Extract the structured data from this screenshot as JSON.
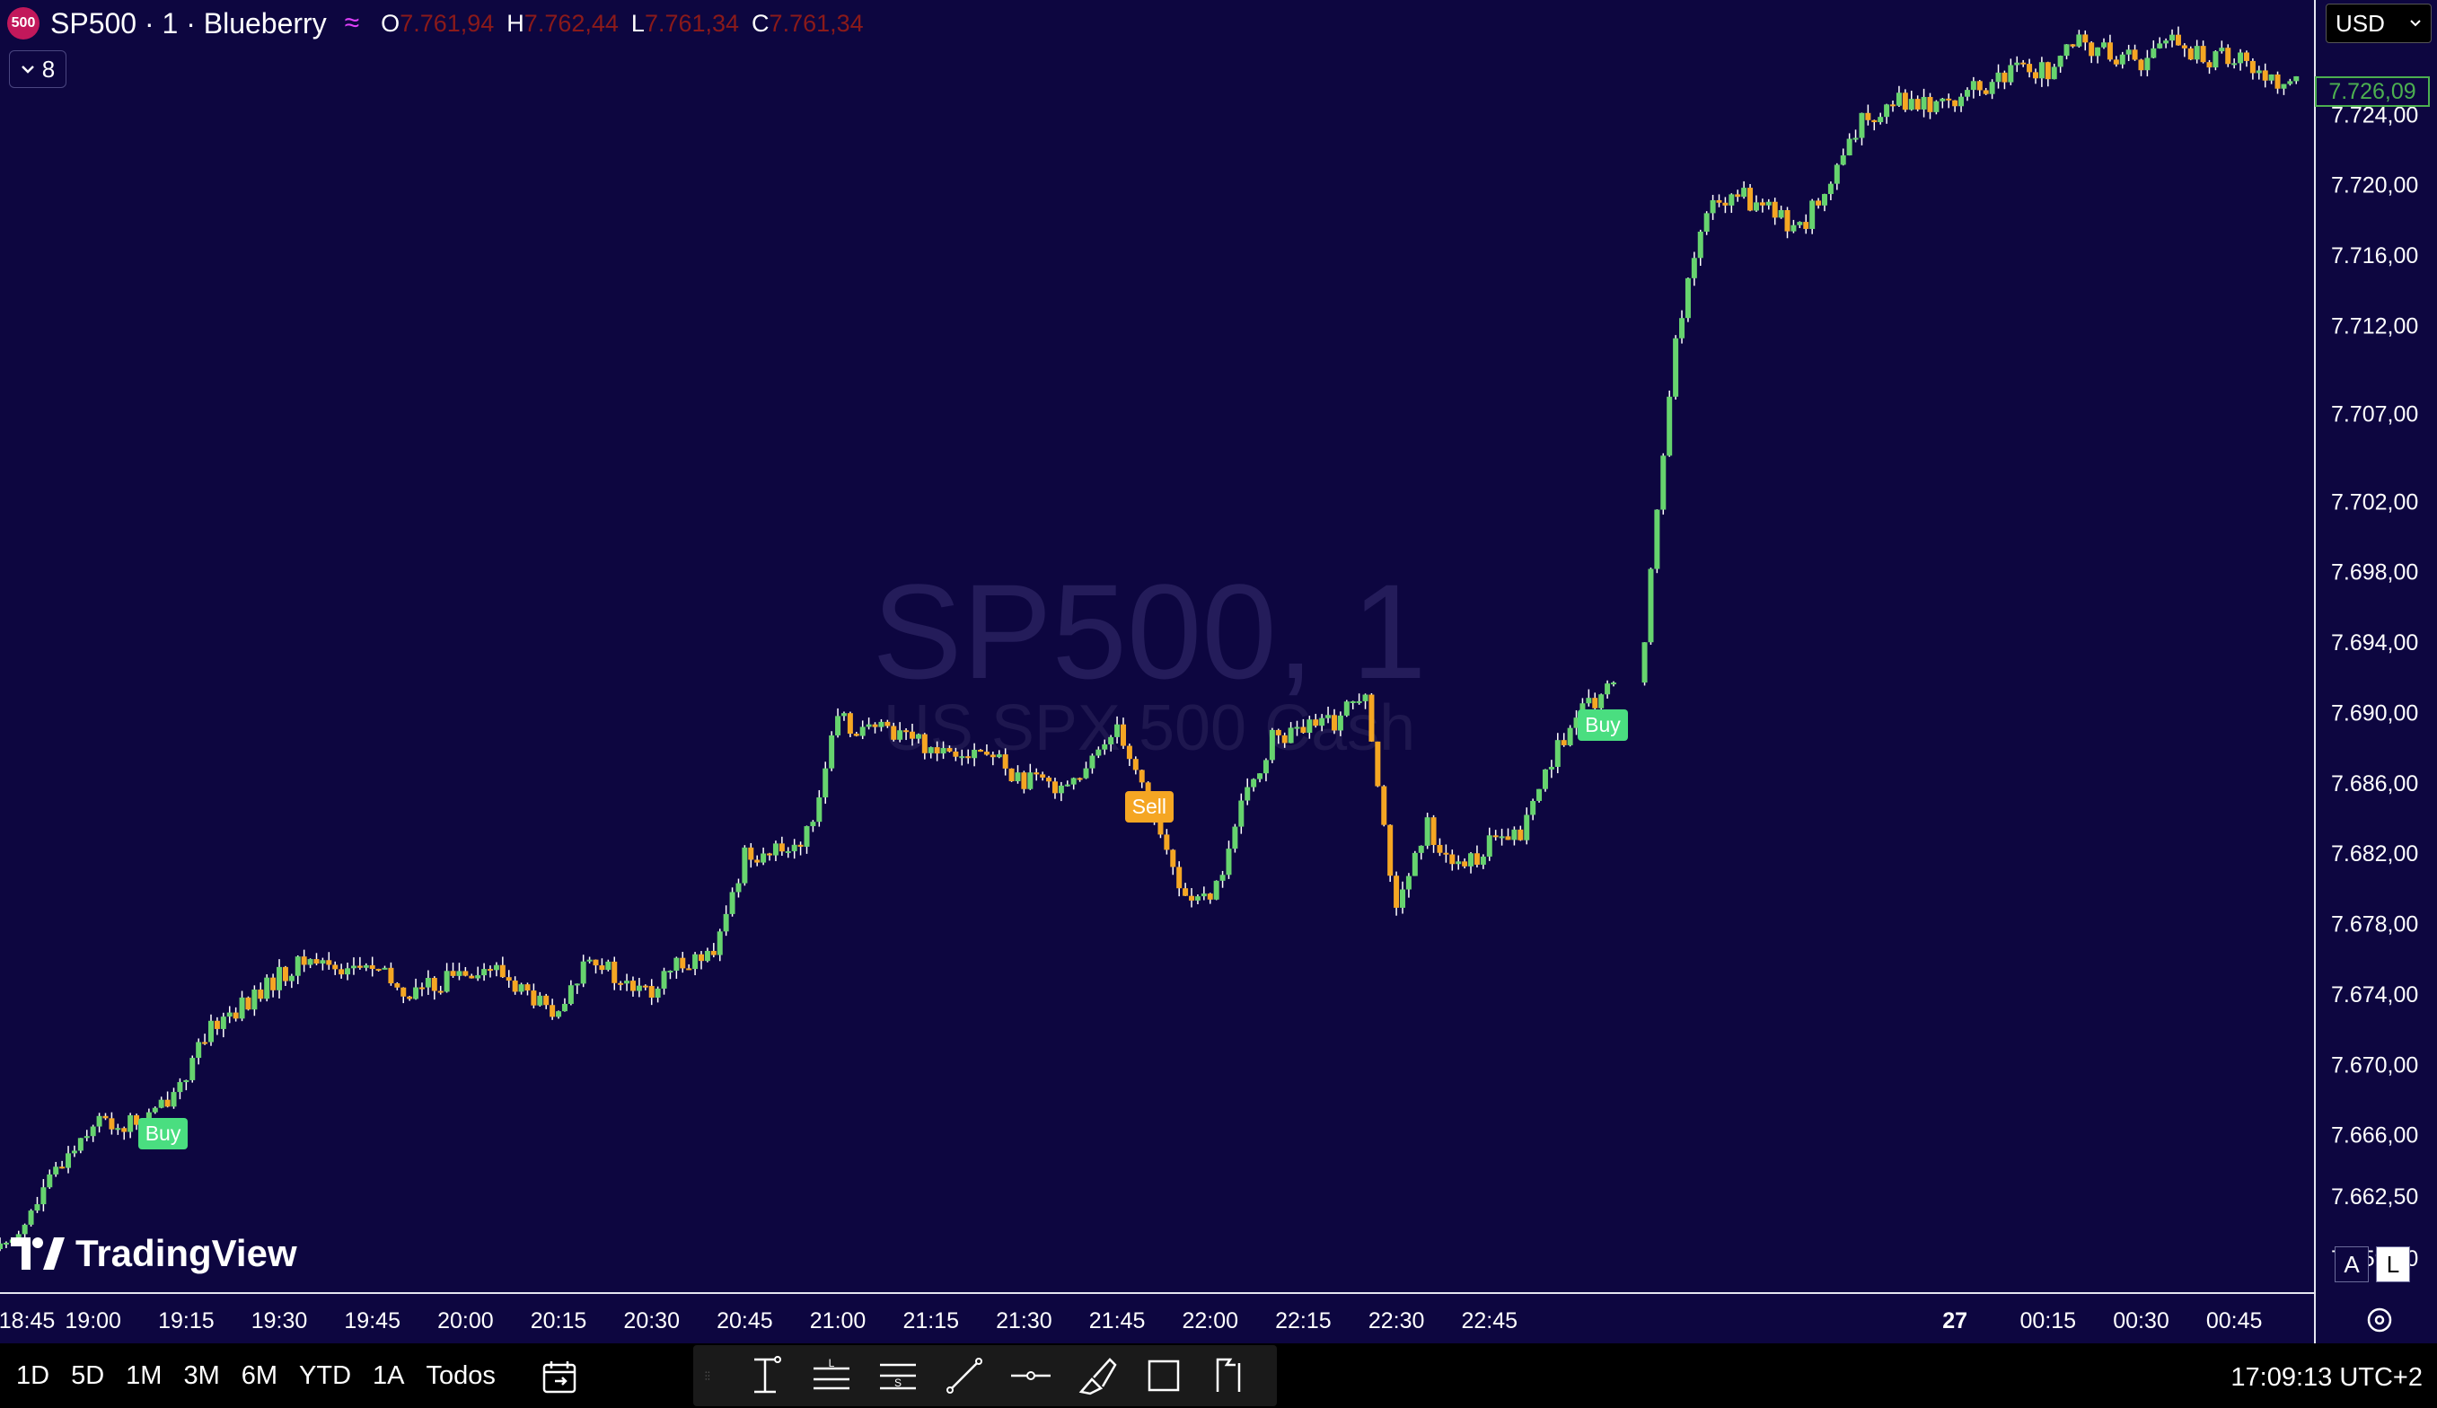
{
  "header": {
    "symbol_badge": "500",
    "title": "SP500 · 1 · Blueberry",
    "ohlc": [
      {
        "key": "O",
        "value": "7.761,94"
      },
      {
        "key": "H",
        "value": "7.762,44"
      },
      {
        "key": "L",
        "value": "7.761,34"
      },
      {
        "key": "C",
        "value": "7.761,34"
      }
    ],
    "indicator_count": "8"
  },
  "currency": "USD",
  "watermark": {
    "symbol": "SP500, 1",
    "description": "US SPX 500 Cash"
  },
  "brand": "TradingView",
  "last_price": "7.726,09",
  "price_scale": [
    "7.724,00",
    "7.720,00",
    "7.716,00",
    "7.712,00",
    "7.707,00",
    "7.702,00",
    "7.698,00",
    "7.694,00",
    "7.690,00",
    "7.686,00",
    "7.682,00",
    "7.678,00",
    "7.674,00",
    "7.670,00",
    "7.666,00",
    "7.662,50",
    "7.659,00"
  ],
  "time_scale": [
    "18:45",
    "19:00",
    "19:15",
    "19:30",
    "19:45",
    "20:00",
    "20:15",
    "20:30",
    "20:45",
    "21:00",
    "21:15",
    "21:30",
    "21:45",
    "22:00",
    "22:15",
    "22:30",
    "22:45",
    "27",
    "00:15",
    "00:30",
    "00:45"
  ],
  "scale_buttons": [
    "A",
    "L"
  ],
  "ranges": [
    "1D",
    "5D",
    "1M",
    "3M",
    "6M",
    "YTD",
    "1A",
    "Todos"
  ],
  "clock": "17:09:13 UTC+2",
  "signals": [
    {
      "label": "Buy",
      "type": "buy",
      "time": "19:11"
    },
    {
      "label": "Sell",
      "type": "sell",
      "time": "21:50"
    },
    {
      "label": "Buy",
      "type": "buy",
      "time": "23:03"
    }
  ],
  "colors": {
    "background": "#0d0640",
    "up_candle": "#66d36e",
    "down_candle": "#f5a623",
    "buy_tag": "#4ade80",
    "sell_tag": "#f5a623",
    "ohlc_value": "#8b1a1a"
  },
  "chart_data": {
    "type": "candlestick",
    "x": [
      "18:45",
      "18:50",
      "18:55",
      "19:00",
      "19:05",
      "19:10",
      "19:15",
      "19:20",
      "19:25",
      "19:30",
      "19:35",
      "19:40",
      "19:45",
      "19:50",
      "19:55",
      "20:00",
      "20:05",
      "20:10",
      "20:15",
      "20:20",
      "20:25",
      "20:30",
      "20:35",
      "20:40",
      "20:45",
      "20:50",
      "20:55",
      "21:00",
      "21:05",
      "21:10",
      "21:15",
      "21:20",
      "21:25",
      "21:30",
      "21:35",
      "21:40",
      "21:45",
      "21:50",
      "21:55",
      "22:00",
      "22:05",
      "22:10",
      "22:15",
      "22:20",
      "22:25",
      "22:30",
      "22:35",
      "22:40",
      "22:45",
      "22:50",
      "22:55",
      "23:00",
      "23:05",
      "23:10",
      "23:15",
      "23:20",
      "23:25",
      "23:30",
      "23:35",
      "23:40",
      "23:45",
      "23:50",
      "23:55",
      "00:00",
      "00:05",
      "00:10",
      "00:15",
      "00:20",
      "00:25",
      "00:30",
      "00:35",
      "00:40",
      "00:45",
      "00:50",
      "00:55"
    ],
    "y": [
      7659.5,
      7661.5,
      7664.5,
      7666.8,
      7666.5,
      7667.2,
      7669.5,
      7672.5,
      7673.5,
      7675.0,
      7676.0,
      7675.5,
      7675.5,
      7674.0,
      7674.5,
      7675.5,
      7675.3,
      7674.0,
      7672.5,
      7676.5,
      7674.5,
      7674.0,
      7676.0,
      7676.0,
      7682.0,
      7682.0,
      7683.0,
      7689.5,
      7689.0,
      7689.0,
      7688.0,
      7688.0,
      7687.5,
      7686.0,
      7686.0,
      7686.5,
      7689.5,
      7685.0,
      7680.0,
      7679.0,
      7684.5,
      7688.5,
      7689.0,
      7689.5,
      7691.5,
      7678.5,
      7683.5,
      7681.0,
      7682.5,
      7683.0,
      7687.5,
      7690.0,
      7691.5,
      7694.5,
      7711.5,
      7718.5,
      7719.5,
      7718.5,
      7717.5,
      7720.0,
      7723.5,
      7725.0,
      7724.5,
      7725.0,
      7725.5,
      7726.5,
      7726.5,
      7728.0,
      7727.5,
      7727.0,
      7728.5,
      7727.0,
      7727.5,
      7726.0,
      7726.1
    ],
    "ylim": [
      7657.0,
      7730.5
    ],
    "xlim": [
      "18:45",
      "00:58"
    ]
  }
}
